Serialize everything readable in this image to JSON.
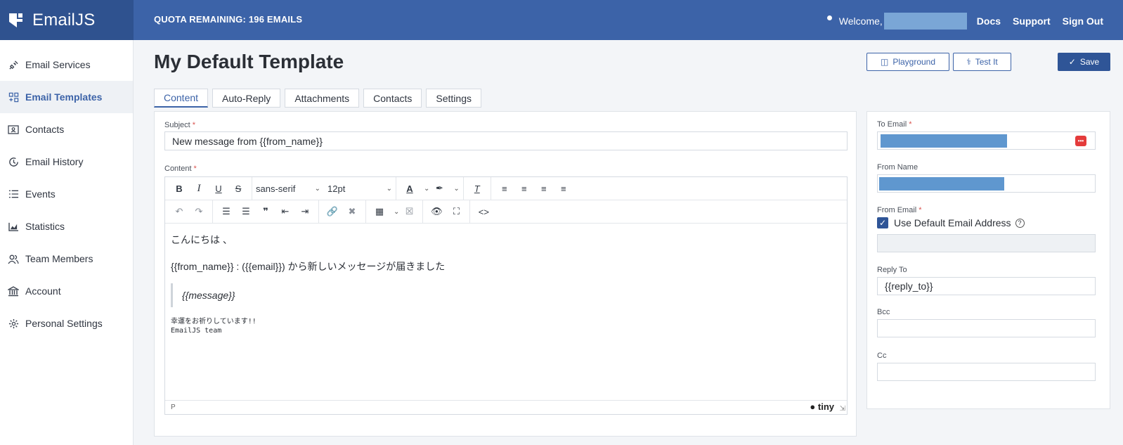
{
  "brand": {
    "name": "EmailJS"
  },
  "header": {
    "quota": "QUOTA REMAINING: 196 EMAILS",
    "welcome": "Welcome,",
    "links": {
      "docs": "Docs",
      "support": "Support",
      "signout": "Sign Out"
    }
  },
  "sidebar": {
    "items": [
      {
        "label": "Email Services",
        "icon": "plug-icon"
      },
      {
        "label": "Email Templates",
        "icon": "templates-icon"
      },
      {
        "label": "Contacts",
        "icon": "contact-card-icon"
      },
      {
        "label": "Email History",
        "icon": "history-icon"
      },
      {
        "label": "Events",
        "icon": "list-icon"
      },
      {
        "label": "Statistics",
        "icon": "chart-icon"
      },
      {
        "label": "Team Members",
        "icon": "team-icon"
      },
      {
        "label": "Account",
        "icon": "bank-icon"
      },
      {
        "label": "Personal Settings",
        "icon": "gear-icon"
      }
    ]
  },
  "page": {
    "title": "My Default Template",
    "buttons": {
      "playground": "Playground",
      "test": "Test It",
      "save": "Save"
    }
  },
  "tabs": [
    "Content",
    "Auto-Reply",
    "Attachments",
    "Contacts",
    "Settings"
  ],
  "form": {
    "subject_label": "Subject",
    "subject_value": "New message from {{from_name}}",
    "content_label": "Content",
    "required_mark": "*"
  },
  "editor": {
    "font_family": "sans-serif",
    "font_size": "12pt",
    "body": {
      "greeting": "こんにちは 、",
      "line2": "{{from_name}} : ({{email}}) から新しいメッセージが届きました",
      "quote": "{{message}}",
      "closing1": "幸運をお祈りしています!!",
      "closing2": "EmailJS team"
    },
    "status_path": "P",
    "branding": "tiny"
  },
  "right_panel": {
    "to_email_label": "To Email",
    "from_name_label": "From Name",
    "from_email_label": "From Email",
    "use_default_label": "Use Default Email Address",
    "use_default_checked": true,
    "reply_to_label": "Reply To",
    "reply_to_value": "{{reply_to}}",
    "bcc_label": "Bcc",
    "cc_label": "Cc"
  },
  "colors": {
    "topbar": "#3c63a8",
    "brand_bg": "#2f528f",
    "accent": "#3c63a8",
    "save_button": "#2f5597",
    "required": "#d9534f",
    "redaction": "#5f97cf"
  }
}
